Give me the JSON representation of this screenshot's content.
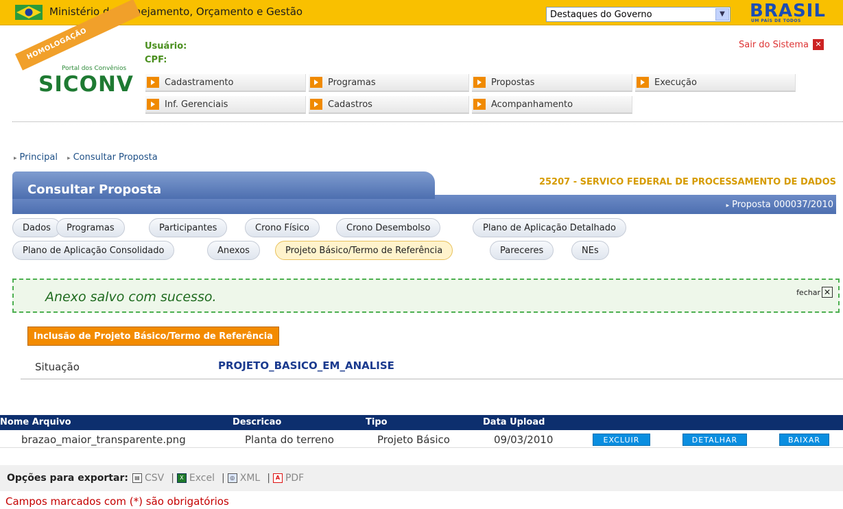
{
  "govbar": {
    "ministry": "Ministério do Planejamento, Orçamento e Gestão",
    "destaques": "Destaques do Governo",
    "brand": "BRASIL",
    "brand_sub": "UM PAÍS DE TODOS"
  },
  "header": {
    "ribbon": "HOMOLOGAÇÃO",
    "portal": "Portal dos Convênios",
    "logo": "SICONV",
    "usuario": "Usuário:",
    "cpf": "CPF:",
    "sair": "Sair do Sistema"
  },
  "menu": {
    "items": [
      "Cadastramento",
      "Programas",
      "Propostas",
      "Execução",
      "Inf. Gerenciais",
      "Cadastros",
      "Acompanhamento"
    ]
  },
  "breadcrumb": [
    "Principal",
    "Consultar Proposta"
  ],
  "page": {
    "title": "Consultar Proposta",
    "org": "25207 - SERVICO FEDERAL DE PROCESSAMENTO DE DADOS",
    "proposta": "Proposta 000037/2010"
  },
  "tabs": [
    "Dados",
    "Programas",
    "Participantes",
    "Crono Físico",
    "Crono Desembolso",
    "Plano de Aplicação Detalhado",
    "Plano de Aplicação Consolidado",
    "Anexos",
    "Projeto Básico/Termo de Referência",
    "Pareceres",
    "NEs"
  ],
  "active_tab": "Projeto Básico/Termo de Referência",
  "success": {
    "message": "Anexo salvo com sucesso.",
    "close": "fechar"
  },
  "section": {
    "button": "Inclusão de Projeto Básico/Termo de Referência",
    "situacao_label": "Situação",
    "situacao_value": "PROJETO_BASICO_EM_ANALISE"
  },
  "table": {
    "headers": [
      "Nome Arquivo",
      "Descricao",
      "Tipo",
      "Data Upload"
    ],
    "rows": [
      {
        "nome": "brazao_maior_transparente.png",
        "descricao": "Planta do terreno",
        "tipo": "Projeto Básico",
        "data": "09/03/2010",
        "actions": [
          "EXCLUIR",
          "DETALHAR",
          "BAIXAR"
        ]
      }
    ]
  },
  "export": {
    "label": "Opções para exportar:",
    "options": [
      "CSV",
      "Excel",
      "XML",
      "PDF"
    ]
  },
  "footer": {
    "required": "Campos marcados com (*) são obrigatórios"
  },
  "colors": {
    "govbar": "#f9c000",
    "title_band": "#4d6fb0",
    "table_header": "#0d2f6e",
    "action_button": "#0a8ee0",
    "section_button": "#f38b00"
  }
}
